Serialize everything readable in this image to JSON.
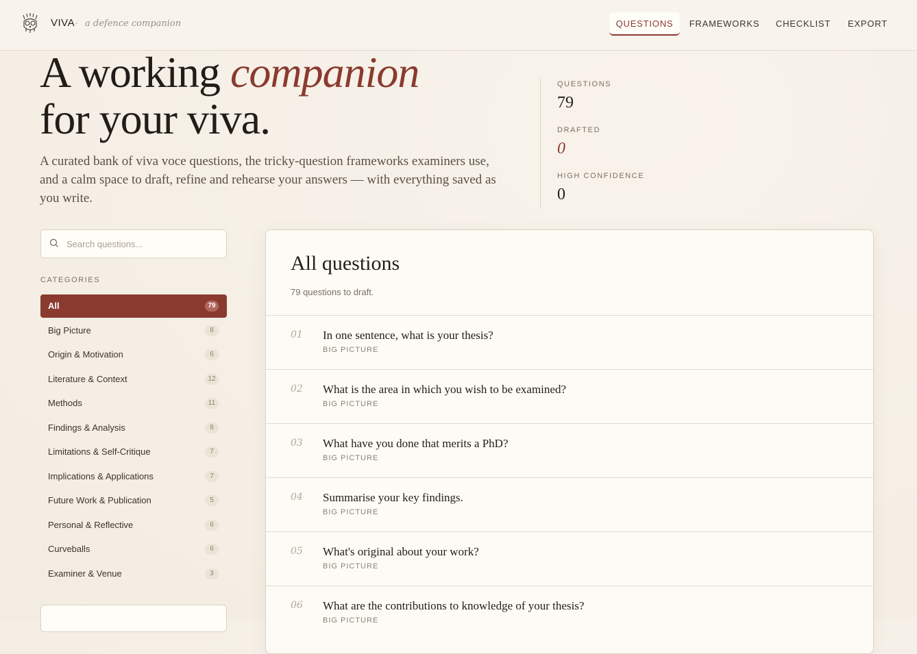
{
  "brand": {
    "name": "VIVA",
    "dot": "·",
    "tagline": "a defence companion",
    "logo_icon": "owl-icon"
  },
  "nav": [
    "QUESTIONS",
    "FRAMEWORKS",
    "CHECKLIST",
    "EXPORT"
  ],
  "nav_active": "QUESTIONS",
  "hero": {
    "title_part1": "A working",
    "title_accent": "companion",
    "title_part2": "for your viva.",
    "description": "A curated bank of viva voce questions, the tricky-question frameworks examiners use, and a calm space to draft, refine and rehearse your answers — with everything saved as you write."
  },
  "stats": [
    {
      "label": "QUESTIONS",
      "value": "79"
    },
    {
      "label": "DRAFTED",
      "value": "0"
    },
    {
      "label": "HIGH CONFIDENCE",
      "value": "0"
    }
  ],
  "search": {
    "placeholder": "Search questions...",
    "icon": "search-icon"
  },
  "categories_heading": "CATEGORIES",
  "categories": [
    {
      "label": "All",
      "count": "79",
      "active": true
    },
    {
      "label": "Big Picture",
      "count": "8"
    },
    {
      "label": "Origin & Motivation",
      "count": "6"
    },
    {
      "label": "Literature & Context",
      "count": "12"
    },
    {
      "label": "Methods",
      "count": "11"
    },
    {
      "label": "Findings & Analysis",
      "count": "8"
    },
    {
      "label": "Limitations & Self-Critique",
      "count": "7"
    },
    {
      "label": "Implications & Applications",
      "count": "7"
    },
    {
      "label": "Future Work & Publication",
      "count": "5"
    },
    {
      "label": "Personal & Reflective",
      "count": "6"
    },
    {
      "label": "Curveballs",
      "count": "6"
    },
    {
      "label": "Examiner & Venue",
      "count": "3"
    }
  ],
  "panel": {
    "title": "All questions",
    "subtitle": "79 questions to draft."
  },
  "questions": [
    {
      "num": "01",
      "text": "In one sentence, what is your thesis?",
      "category": "BIG PICTURE"
    },
    {
      "num": "02",
      "text": "What is the area in which you wish to be examined?",
      "category": "BIG PICTURE"
    },
    {
      "num": "03",
      "text": "What have you done that merits a PhD?",
      "category": "BIG PICTURE"
    },
    {
      "num": "04",
      "text": "Summarise your key findings.",
      "category": "BIG PICTURE"
    },
    {
      "num": "05",
      "text": "What's original about your work?",
      "category": "BIG PICTURE"
    },
    {
      "num": "06",
      "text": "What are the contributions to knowledge of your thesis?",
      "category": "BIG PICTURE"
    }
  ],
  "colors": {
    "accent": "#8b3a2f",
    "background": "#f5efe6",
    "panel": "#fdfbf6"
  }
}
